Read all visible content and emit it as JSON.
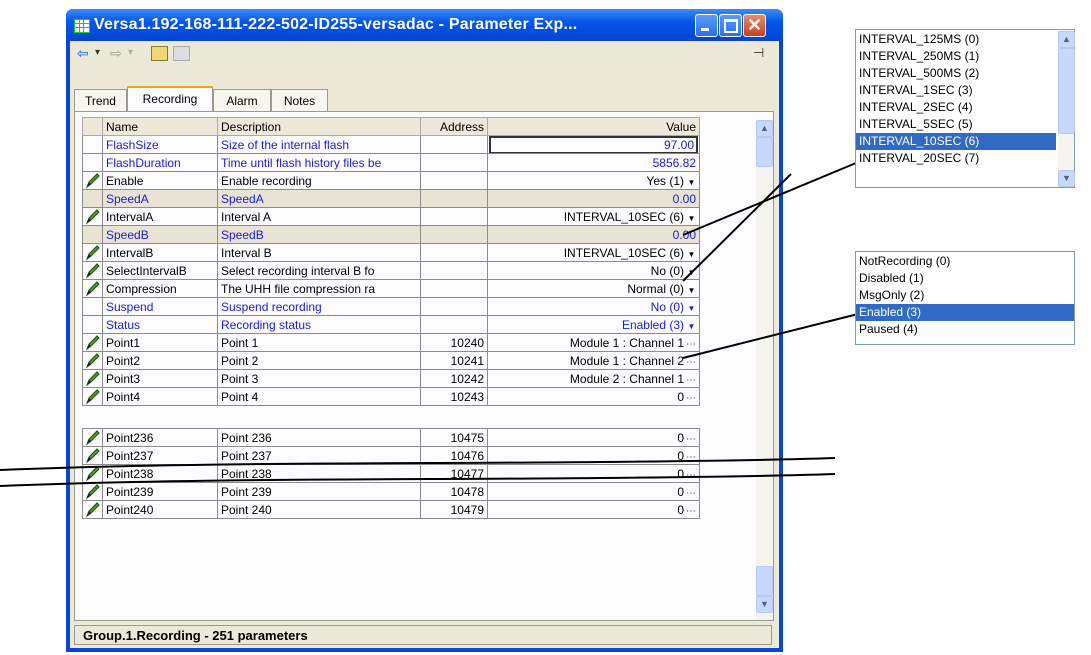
{
  "window": {
    "title": "Versa1.192-168-111-222-502-ID255-versadac - Parameter Exp..."
  },
  "toolbar": {
    "back": "⇦",
    "back_drop": "▾",
    "forward": "⇨",
    "forward_drop": "▾",
    "pin": "⊣"
  },
  "tabs": [
    "Trend",
    "Recording",
    "Alarm",
    "Notes"
  ],
  "active_tab": "Recording",
  "columns": {
    "name": "Name",
    "description": "Description",
    "address": "Address",
    "value": "Value"
  },
  "rows_top": [
    {
      "icon": "",
      "name": "FlashSize",
      "description": "Size of the internal flash",
      "address": "",
      "value": "97.00",
      "blue": true,
      "control": "edit"
    },
    {
      "icon": "",
      "name": "FlashDuration",
      "description": "Time until flash history files be",
      "address": "",
      "value": "5856.82",
      "blue": true,
      "control": ""
    },
    {
      "icon": "pencil",
      "name": "Enable",
      "description": "Enable recording",
      "address": "",
      "value": "Yes (1)",
      "blue": false,
      "control": "dropdown"
    },
    {
      "icon": "",
      "name": "SpeedA",
      "description": "SpeedA",
      "address": "",
      "value": "0.00",
      "blue": true,
      "control": "",
      "hl": true
    },
    {
      "icon": "pencil",
      "name": "IntervalA",
      "description": "Interval A",
      "address": "",
      "value": "INTERVAL_10SEC (6)",
      "blue": false,
      "control": "dropdown"
    },
    {
      "icon": "",
      "name": "SpeedB",
      "description": "SpeedB",
      "address": "",
      "value": "0.00",
      "blue": true,
      "control": "",
      "hl": true
    },
    {
      "icon": "pencil",
      "name": "IntervalB",
      "description": "Interval B",
      "address": "",
      "value": "INTERVAL_10SEC (6)",
      "blue": false,
      "control": "dropdown"
    },
    {
      "icon": "pencil",
      "name": "SelectIntervalB",
      "description": "Select recording interval B fo",
      "address": "",
      "value": "No (0)",
      "blue": false,
      "control": "dropdown"
    },
    {
      "icon": "pencil",
      "name": "Compression",
      "description": "The UHH file compression ra",
      "address": "",
      "value": "Normal (0)",
      "blue": false,
      "control": "dropdown"
    },
    {
      "icon": "",
      "name": "Suspend",
      "description": "Suspend recording",
      "address": "",
      "value": "No (0)",
      "blue": true,
      "control": "dropdown"
    },
    {
      "icon": "",
      "name": "Status",
      "description": "Recording status",
      "address": "",
      "value": "Enabled (3)",
      "blue": true,
      "control": "dropdown"
    },
    {
      "icon": "pencil",
      "name": "Point1",
      "description": "Point 1",
      "address": "10240",
      "value": "Module 1 : Channel 1",
      "blue": false,
      "control": "ellipsis"
    },
    {
      "icon": "pencil",
      "name": "Point2",
      "description": "Point 2",
      "address": "10241",
      "value": "Module 1 : Channel 2",
      "blue": false,
      "control": "ellipsis"
    },
    {
      "icon": "pencil",
      "name": "Point3",
      "description": "Point 3",
      "address": "10242",
      "value": "Module 2 : Channel 1",
      "blue": false,
      "control": "ellipsis"
    },
    {
      "icon": "pencil",
      "name": "Point4",
      "description": "Point 4",
      "address": "10243",
      "value": "0",
      "blue": false,
      "control": "ellipsis"
    }
  ],
  "rows_bottom": [
    {
      "icon": "pencil",
      "name": "Point236",
      "description": "Point 236",
      "address": "10475",
      "value": "0",
      "blue": false,
      "control": "ellipsis"
    },
    {
      "icon": "pencil",
      "name": "Point237",
      "description": "Point 237",
      "address": "10476",
      "value": "0",
      "blue": false,
      "control": "ellipsis"
    },
    {
      "icon": "pencil",
      "name": "Point238",
      "description": "Point 238",
      "address": "10477",
      "value": "0",
      "blue": false,
      "control": "ellipsis"
    },
    {
      "icon": "pencil",
      "name": "Point239",
      "description": "Point 239",
      "address": "10478",
      "value": "0",
      "blue": false,
      "control": "ellipsis"
    },
    {
      "icon": "pencil",
      "name": "Point240",
      "description": "Point 240",
      "address": "10479",
      "value": "0",
      "blue": false,
      "control": "ellipsis"
    }
  ],
  "status_bar": "Group.1.Recording  -  251 parameters",
  "interval_options": [
    "INTERVAL_125MS (0)",
    "INTERVAL_250MS (1)",
    "INTERVAL_500MS (2)",
    "INTERVAL_1SEC (3)",
    "INTERVAL_2SEC (4)",
    "INTERVAL_5SEC (5)",
    "INTERVAL_10SEC (6)",
    "INTERVAL_20SEC (7)"
  ],
  "interval_selected": "INTERVAL_10SEC (6)",
  "status_options": [
    "NotRecording (0)",
    "Disabled (1)",
    "MsgOnly (2)",
    "Enabled (3)",
    "Paused (4)"
  ],
  "status_selected": "Enabled (3)",
  "colors": {
    "title_bar": "#0556e8",
    "param_blue": "#1c1cd8",
    "selection": "#316ac5",
    "active_tab_accent": "#f7a31a"
  }
}
